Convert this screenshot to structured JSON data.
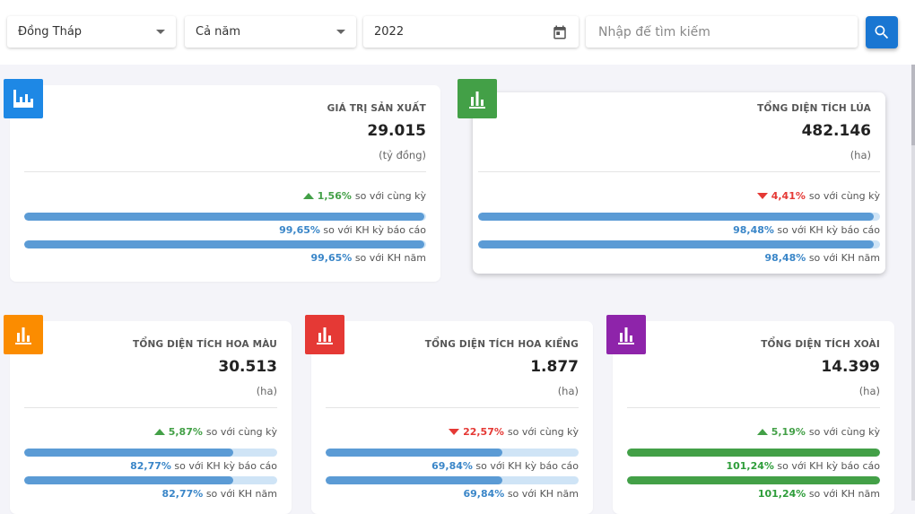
{
  "filters": {
    "province": "Đồng Tháp",
    "period": "Cả năm",
    "year": "2022",
    "search_placeholder": "Nhập để tìm kiếm"
  },
  "compare_text": "so với cùng kỳ",
  "plan_report_text": "so với KH kỳ báo cáo",
  "plan_year_text": "so với KH năm",
  "cards": [
    {
      "title": "GIÁ TRỊ SẢN XUẤT",
      "value": "29.015",
      "unit": "(tỷ đồng)",
      "badge_color": "#1e88e5",
      "icon": "area-chart-icon",
      "trend": "up",
      "change": "1,56%",
      "plan_report_pct": "99,65%",
      "plan_report_fill": 0.9965,
      "plan_year_pct": "99,65%",
      "plan_year_fill": 0.9965
    },
    {
      "title": "TỔNG DIỆN TÍCH LÚA",
      "value": "482.146",
      "unit": "(ha)",
      "badge_color": "#43a047",
      "icon": "bar-chart-icon",
      "trend": "down",
      "change": "4,41%",
      "plan_report_pct": "98,48%",
      "plan_report_fill": 0.9848,
      "plan_year_pct": "98,48%",
      "plan_year_fill": 0.9848
    },
    {
      "title": "TỔNG DIỆN TÍCH HOA MÀU",
      "value": "30.513",
      "unit": "(ha)",
      "badge_color": "#fb8c00",
      "icon": "bar-chart-icon",
      "trend": "up",
      "change": "5,87%",
      "plan_report_pct": "82,77%",
      "plan_report_fill": 0.8277,
      "plan_year_pct": "82,77%",
      "plan_year_fill": 0.8277
    },
    {
      "title": "TỔNG DIỆN TÍCH HOA KIỂNG",
      "value": "1.877",
      "unit": "(ha)",
      "badge_color": "#e53935",
      "icon": "bar-chart-icon",
      "trend": "down",
      "change": "22,57%",
      "plan_report_pct": "69,84%",
      "plan_report_fill": 0.6984,
      "plan_year_pct": "69,84%",
      "plan_year_fill": 0.6984
    },
    {
      "title": "TỔNG DIỆN TÍCH XOÀI",
      "value": "14.399",
      "unit": "(ha)",
      "badge_color": "#8e24aa",
      "icon": "bar-chart-icon",
      "trend": "up",
      "change": "5,19%",
      "plan_report_pct": "101,24%",
      "plan_report_fill": 1.0,
      "plan_year_pct": "101,24%",
      "plan_year_fill": 1.0,
      "bar_color": "#43a047"
    }
  ]
}
